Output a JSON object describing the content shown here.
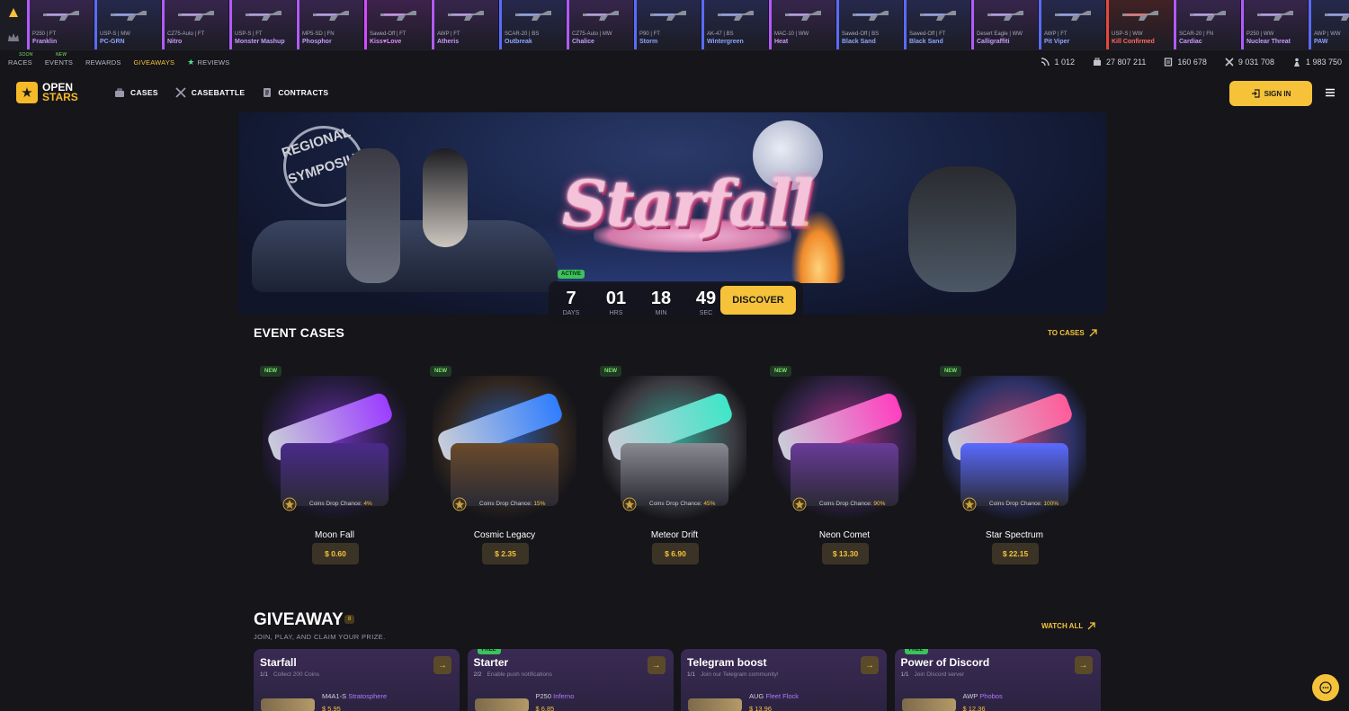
{
  "colors": {
    "accent": "#f5c23a",
    "green": "#3cc25b",
    "bg": "#15151a"
  },
  "live_drops": [
    {
      "model": "P250 | FT",
      "skin": "Franklin",
      "rarity_color": "#b15bff",
      "skin_color": "#c79bff"
    },
    {
      "model": "USP-S | MW",
      "skin": "PC-GRN",
      "rarity_color": "#5a6bff",
      "skin_color": "#8fa2ff"
    },
    {
      "model": "CZ75-Auto | FT",
      "skin": "Nitro",
      "rarity_color": "#b15bff",
      "skin_color": "#c79bff"
    },
    {
      "model": "USP-S | FT",
      "skin": "Monster Mashup",
      "rarity_color": "#b15bff",
      "skin_color": "#c79bff"
    },
    {
      "model": "MP5-SD | FN",
      "skin": "Phosphor",
      "rarity_color": "#b15bff",
      "skin_color": "#c79bff"
    },
    {
      "model": "Sawed-Off | FT",
      "skin": "Kiss♥Love",
      "rarity_color": "#d54bff",
      "skin_color": "#e18bff"
    },
    {
      "model": "AWP | FT",
      "skin": "Atheris",
      "rarity_color": "#b15bff",
      "skin_color": "#c79bff"
    },
    {
      "model": "SCAR-20 | BS",
      "skin": "Outbreak",
      "rarity_color": "#5a6bff",
      "skin_color": "#8fa2ff"
    },
    {
      "model": "CZ75-Auto | MW",
      "skin": "Chalice",
      "rarity_color": "#b15bff",
      "skin_color": "#c79bff"
    },
    {
      "model": "P90 | FT",
      "skin": "Storm",
      "rarity_color": "#5a6bff",
      "skin_color": "#8fa2ff"
    },
    {
      "model": "AK-47 | BS",
      "skin": "Wintergreen",
      "rarity_color": "#5a6bff",
      "skin_color": "#8fa2ff"
    },
    {
      "model": "MAC-10 | WW",
      "skin": "Heat",
      "rarity_color": "#b15bff",
      "skin_color": "#c79bff"
    },
    {
      "model": "Sawed-Off | BS",
      "skin": "Black Sand",
      "rarity_color": "#5a6bff",
      "skin_color": "#8fa2ff"
    },
    {
      "model": "Sawed-Off | FT",
      "skin": "Black Sand",
      "rarity_color": "#5a6bff",
      "skin_color": "#8fa2ff"
    },
    {
      "model": "Desert Eagle | WW",
      "skin": "Calligraffiti",
      "rarity_color": "#b15bff",
      "skin_color": "#c79bff"
    },
    {
      "model": "AWP | FT",
      "skin": "Pit Viper",
      "rarity_color": "#5a6bff",
      "skin_color": "#8fa2ff"
    },
    {
      "model": "USP-S | WW",
      "skin": "Kill Confirmed",
      "rarity_color": "#e6493b",
      "skin_color": "#ff6b5e"
    },
    {
      "model": "SCAR-20 | FN",
      "skin": "Cardiac",
      "rarity_color": "#b15bff",
      "skin_color": "#c79bff"
    },
    {
      "model": "P250 | WW",
      "skin": "Nuclear Threat",
      "rarity_color": "#b15bff",
      "skin_color": "#c79bff"
    },
    {
      "model": "AWP | WW",
      "skin": "PAW",
      "rarity_color": "#5a6bff",
      "skin_color": "#8fa2ff"
    }
  ],
  "subnav": {
    "races": "RACES",
    "races_tag": "SOON",
    "events": "EVENTS",
    "events_tag": "NEW",
    "rewards": "REWARDS",
    "giveaways": "GIVEAWAYS",
    "reviews": "REVIEWS"
  },
  "stats": {
    "online": "1 012",
    "cases_opened": "27 807 211",
    "contracts": "160 678",
    "battles": "9 031 708",
    "users": "1 983 750"
  },
  "header": {
    "logo_line1": "OPEN",
    "logo_line2": "STARS",
    "nav_cases": "CASES",
    "nav_casebattle": "CASEBATTLE",
    "nav_contracts": "CONTRACTS",
    "signin": "SIGN IN"
  },
  "banner": {
    "title": "Starfall",
    "sign_text": "REGIONAL SYMPOSIUM",
    "status": "ACTIVE",
    "timer": {
      "days": "7",
      "days_label": "DAYS",
      "hrs": "01",
      "hrs_label": "HRS",
      "min": "18",
      "min_label": "MIN",
      "sec": "49",
      "sec_label": "SEC"
    },
    "discover": "DISCOVER"
  },
  "event_cases": {
    "title": "EVENT CASES",
    "link": "TO CASES",
    "chance_label": "Coins Drop Chance:",
    "new_label": "NEW",
    "items": [
      {
        "name": "Moon Fall",
        "price": "$ 0.60",
        "chance": "4%",
        "glow": "#9b3dff",
        "glow2": "#4a2a8a"
      },
      {
        "name": "Cosmic Legacy",
        "price": "$ 2.35",
        "chance": "15%",
        "glow": "#2f7dff",
        "glow2": "#6a4a2a"
      },
      {
        "name": "Meteor Drift",
        "price": "$ 6.90",
        "chance": "45%",
        "glow": "#3ee6c8",
        "glow2": "#8a8a92"
      },
      {
        "name": "Neon Comet",
        "price": "$ 13.30",
        "chance": "90%",
        "glow": "#ff3ebf",
        "glow2": "#6a3a9a"
      },
      {
        "name": "Star Spectrum",
        "price": "$ 22.15",
        "chance": "100%",
        "glow": "#ff5a9a",
        "glow2": "#5a6aff"
      }
    ]
  },
  "giveaway": {
    "title": "GIVEAWAY",
    "count": "8",
    "subtitle": "JOIN, PLAY, AND CLAIM YOUR PRIZE.",
    "link": "WATCH ALL",
    "free_label": "FREE",
    "cards": [
      {
        "title": "Starfall",
        "progress": "1/1",
        "task": "Collect 200 Coins",
        "free": false,
        "item_model": "M4A1-S",
        "item_skin": "Stratosphere",
        "item_price": "$ 5.95"
      },
      {
        "title": "Starter",
        "progress": "2/2",
        "task": "Enable push notifications",
        "free": true,
        "item_model": "P250",
        "item_skin": "Inferno",
        "item_price": "$ 6.85"
      },
      {
        "title": "Telegram boost",
        "progress": "1/1",
        "task": "Join our Telegram community!",
        "free": false,
        "item_model": "AUG",
        "item_skin": "Fleet Flock",
        "item_price": "$ 13.96"
      },
      {
        "title": "Power of Discord",
        "progress": "1/1",
        "task": "Join Discord server",
        "free": true,
        "item_model": "AWP",
        "item_skin": "Phobos",
        "item_price": "$ 12.36"
      }
    ]
  }
}
